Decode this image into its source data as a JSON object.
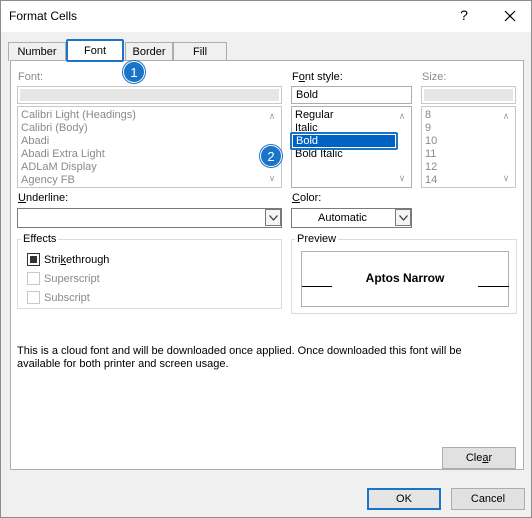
{
  "dialog": {
    "title": "Format Cells",
    "help_label": "?"
  },
  "tabs": [
    {
      "label": "Number"
    },
    {
      "label": "Font"
    },
    {
      "label": "Border"
    },
    {
      "label": "Fill"
    }
  ],
  "font": {
    "label": "Font:",
    "value": "",
    "options": [
      "Calibri Light (Headings)",
      "Calibri (Body)",
      "Abadi",
      "Abadi Extra Light",
      "ADLaM Display",
      "Agency FB"
    ]
  },
  "font_style": {
    "label_prefix": "F",
    "label_u": "o",
    "label_rest": "nt style:",
    "value": "Bold",
    "options": [
      "Regular",
      "Italic",
      "Bold",
      "Bold Italic"
    ],
    "selected": "Bold"
  },
  "size": {
    "label": "Size:",
    "value": "",
    "options": [
      "8",
      "9",
      "10",
      "11",
      "12",
      "14"
    ]
  },
  "underline": {
    "label_u": "U",
    "label_rest": "nderline:",
    "value": ""
  },
  "color": {
    "label_u": "C",
    "label_rest": "olor:",
    "value": "Automatic"
  },
  "effects": {
    "title": "Effects",
    "strikethrough_pre": "Stri",
    "strikethrough_u": "k",
    "strikethrough_post": "ethrough",
    "strikethrough_checked": true,
    "superscript": "Superscript",
    "subscript": "Subscript"
  },
  "preview": {
    "title": "Preview",
    "text": "Aptos Narrow"
  },
  "note": {
    "line1": "This is a cloud font and will be downloaded once applied. Once downloaded this font will be",
    "line2": "available for both printer and screen usage."
  },
  "buttons": {
    "clear_pre": "Cle",
    "clear_u": "a",
    "clear_post": "r",
    "ok": "OK",
    "cancel": "Cancel"
  },
  "badges": {
    "one": "1",
    "two": "2"
  },
  "colors": {
    "accent": "#1b74c7",
    "selection": "#0063c4"
  }
}
